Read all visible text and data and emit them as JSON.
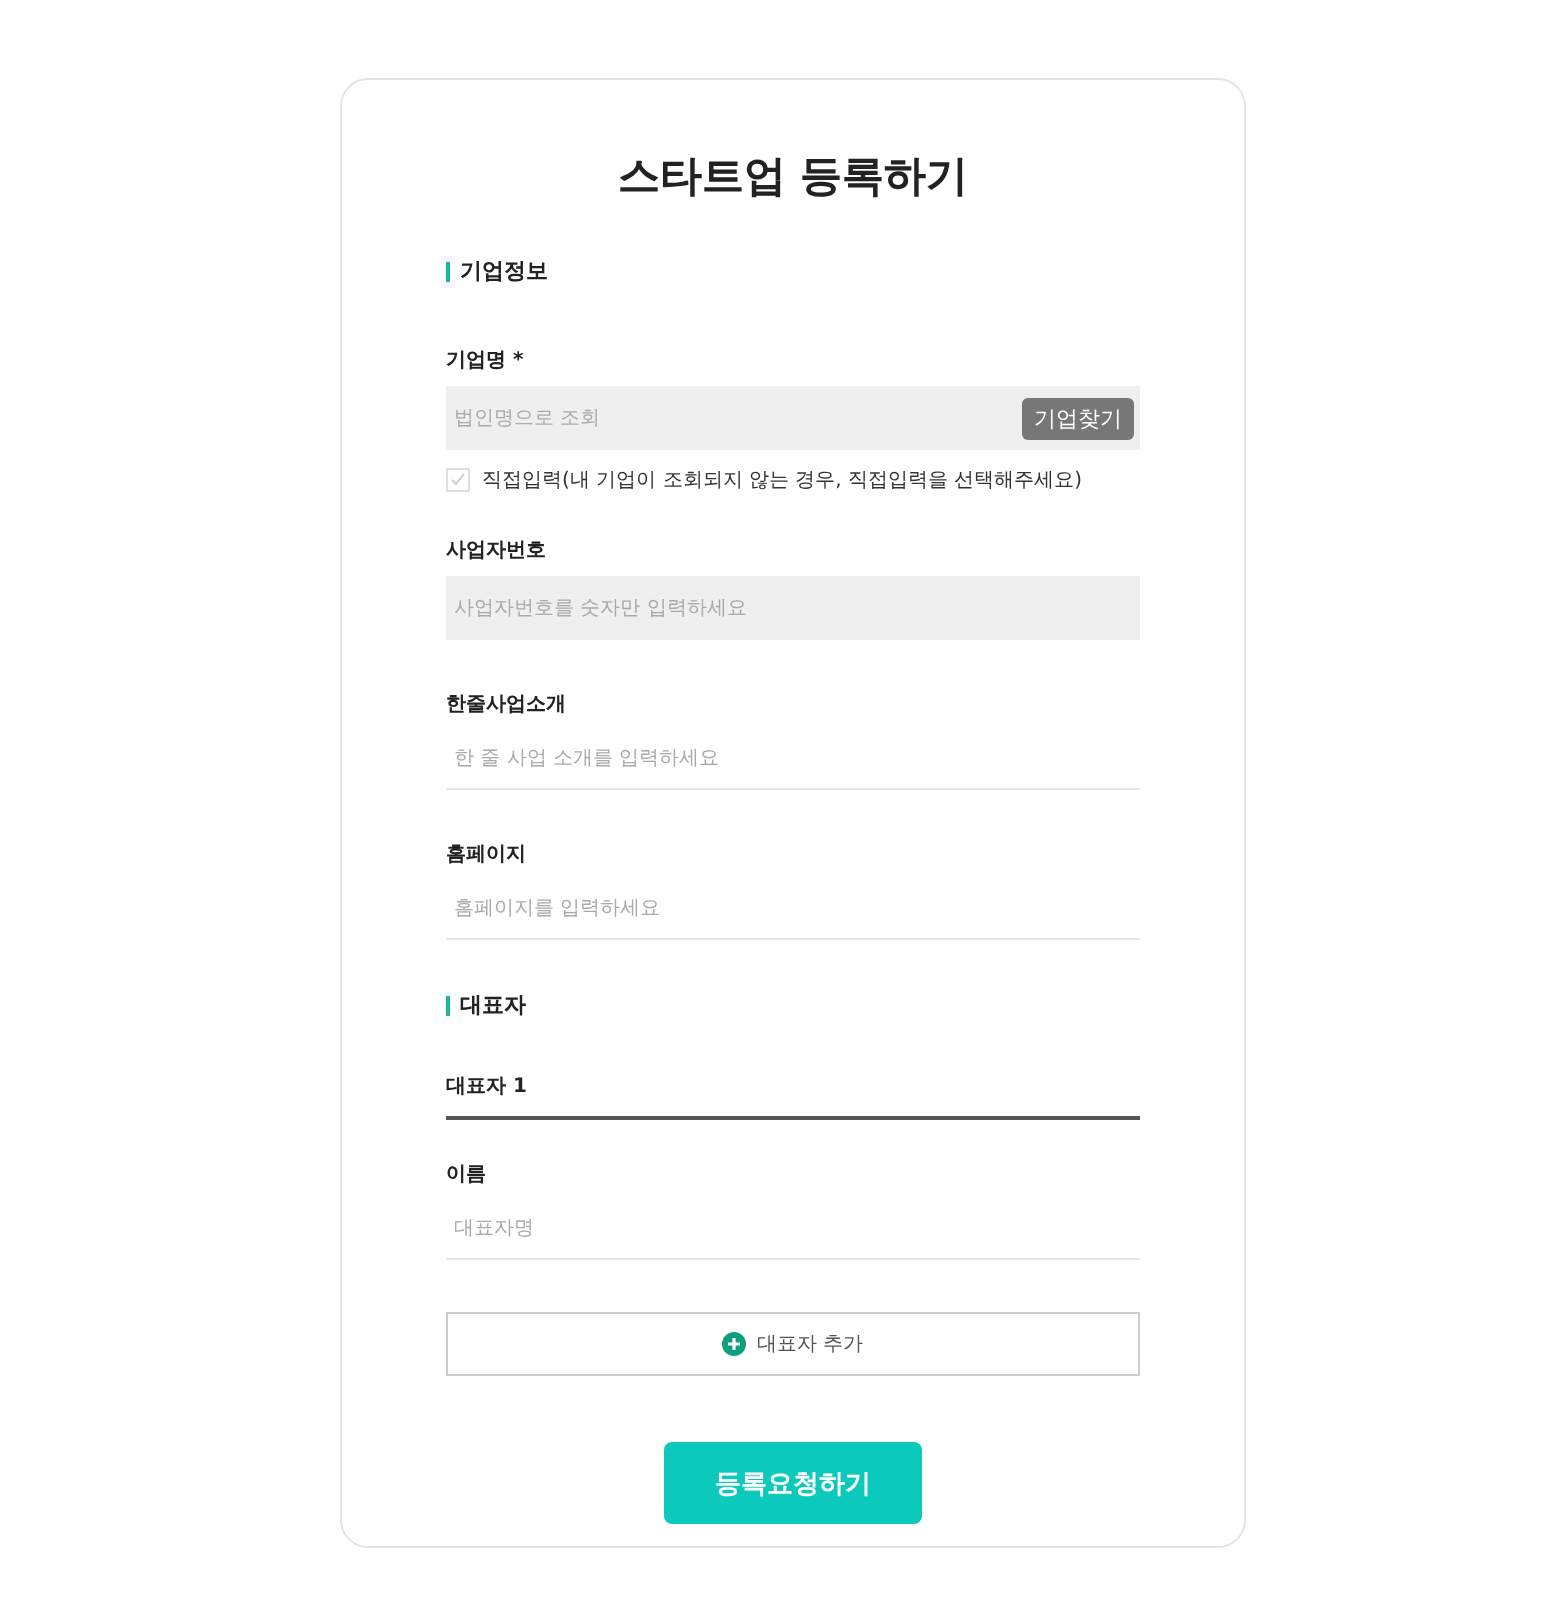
{
  "title": "스타트업 등록하기",
  "sections": [
    {
      "heading": "기업정보",
      "items": [
        {
          "kind": "filled_field",
          "label": "기업명 *",
          "placeholder": "법인명으로 조회",
          "button": "기업찾기"
        },
        {
          "kind": "checkbox",
          "label": "직접입력(내 기업이 조회되지 않는 경우, 직접입력을 선택해주세요)",
          "checked": false
        },
        {
          "kind": "filled_field",
          "label": "사업자번호",
          "placeholder": "사업자번호를 숫자만 입력하세요"
        },
        {
          "kind": "field",
          "label": "한줄사업소개",
          "placeholder": "한 줄 사업 소개를 입력하세요"
        },
        {
          "kind": "field",
          "label": "홈페이지",
          "placeholder": "홈페이지를 입력하세요"
        }
      ]
    },
    {
      "heading": "대표자",
      "items": [
        {
          "kind": "tab",
          "label": "대표자 1"
        },
        {
          "kind": "field",
          "label": "이름",
          "placeholder": "대표자명"
        },
        {
          "kind": "add",
          "label": "대표자 추가"
        }
      ]
    }
  ],
  "submit": "등록요청하기"
}
